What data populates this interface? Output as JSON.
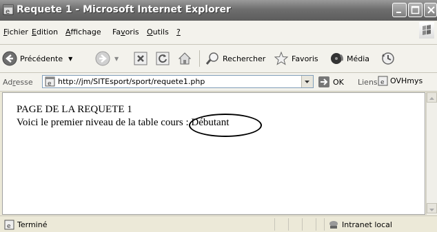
{
  "window": {
    "title": "Requete 1 - Microsoft Internet Explorer"
  },
  "menu": {
    "items": [
      {
        "pre": "",
        "u": "F",
        "post": "ichier"
      },
      {
        "pre": "",
        "u": "E",
        "post": "dition"
      },
      {
        "pre": "",
        "u": "A",
        "post": "ffichage"
      },
      {
        "pre": "Fa",
        "u": "v",
        "post": "oris"
      },
      {
        "pre": "",
        "u": "O",
        "post": "utils"
      },
      {
        "pre": "",
        "u": "?",
        "post": ""
      }
    ]
  },
  "toolbar": {
    "back_label": "Précédente",
    "search_label": "Rechercher",
    "favorites_label": "Favoris",
    "media_label": "Média"
  },
  "address": {
    "label_pre": "Ad",
    "label_u": "r",
    "label_post": "esse",
    "url": "http://jm/SITEsport/sport/requete1.php",
    "go_label": "OK",
    "links_label": "Liens",
    "link_item": "OVHmys"
  },
  "page": {
    "line1": "PAGE DE LA REQUETE 1",
    "line2": "Voici le premier niveau de la table cours : Débutant"
  },
  "status": {
    "text": "Terminé",
    "zone": "Intranet local"
  },
  "colors": {
    "titlebar": "#6e6e6e",
    "chrome": "#ece9d8",
    "content": "#ffffff"
  }
}
